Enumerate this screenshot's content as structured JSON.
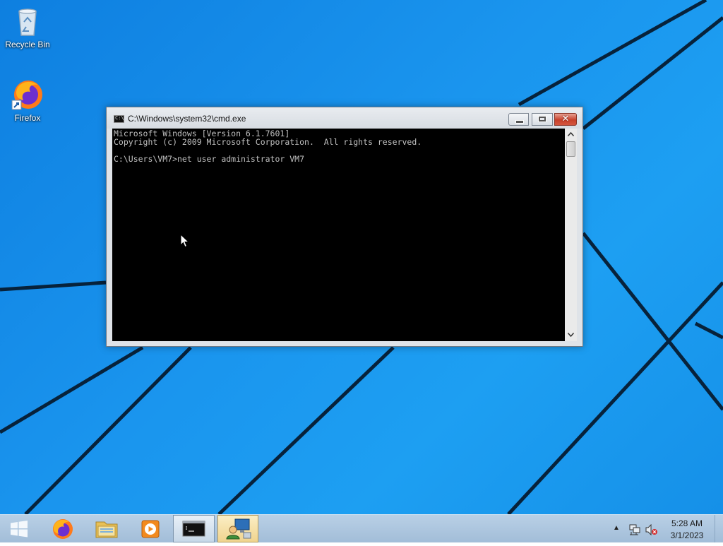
{
  "desktop": {
    "icons": [
      {
        "label": "Recycle Bin",
        "icon": "recycle-bin-icon"
      },
      {
        "label": "Firefox",
        "icon": "firefox-icon"
      }
    ]
  },
  "window": {
    "title": "C:\\Windows\\system32\\cmd.exe",
    "close_glyph": "✕",
    "console_lines": [
      "Microsoft Windows [Version 6.1.7601]",
      "Copyright (c) 2009 Microsoft Corporation.  All rights reserved.",
      "",
      "C:\\Users\\VM7>net user administrator VM7"
    ]
  },
  "taskbar": {
    "pinned": [
      {
        "name": "firefox",
        "icon": "firefox-icon"
      },
      {
        "name": "explorer",
        "icon": "folder-icon"
      },
      {
        "name": "media-player",
        "icon": "media-player-icon"
      },
      {
        "name": "cmd",
        "icon": "cmd-icon",
        "active": true
      },
      {
        "name": "admin-tool",
        "icon": "admin-tool-icon",
        "highlighted": true
      }
    ],
    "cmd_icon_text": "C:\\_",
    "tray": {
      "chevron": "▲",
      "time": "5:28 AM",
      "date": "3/1/2023"
    }
  },
  "colors": {
    "desktop_blue": "#1a95ee",
    "taskbar": "#b9d0e6",
    "console_bg": "#000000",
    "console_text": "#c0c0c0",
    "close_button": "#c7402a"
  }
}
